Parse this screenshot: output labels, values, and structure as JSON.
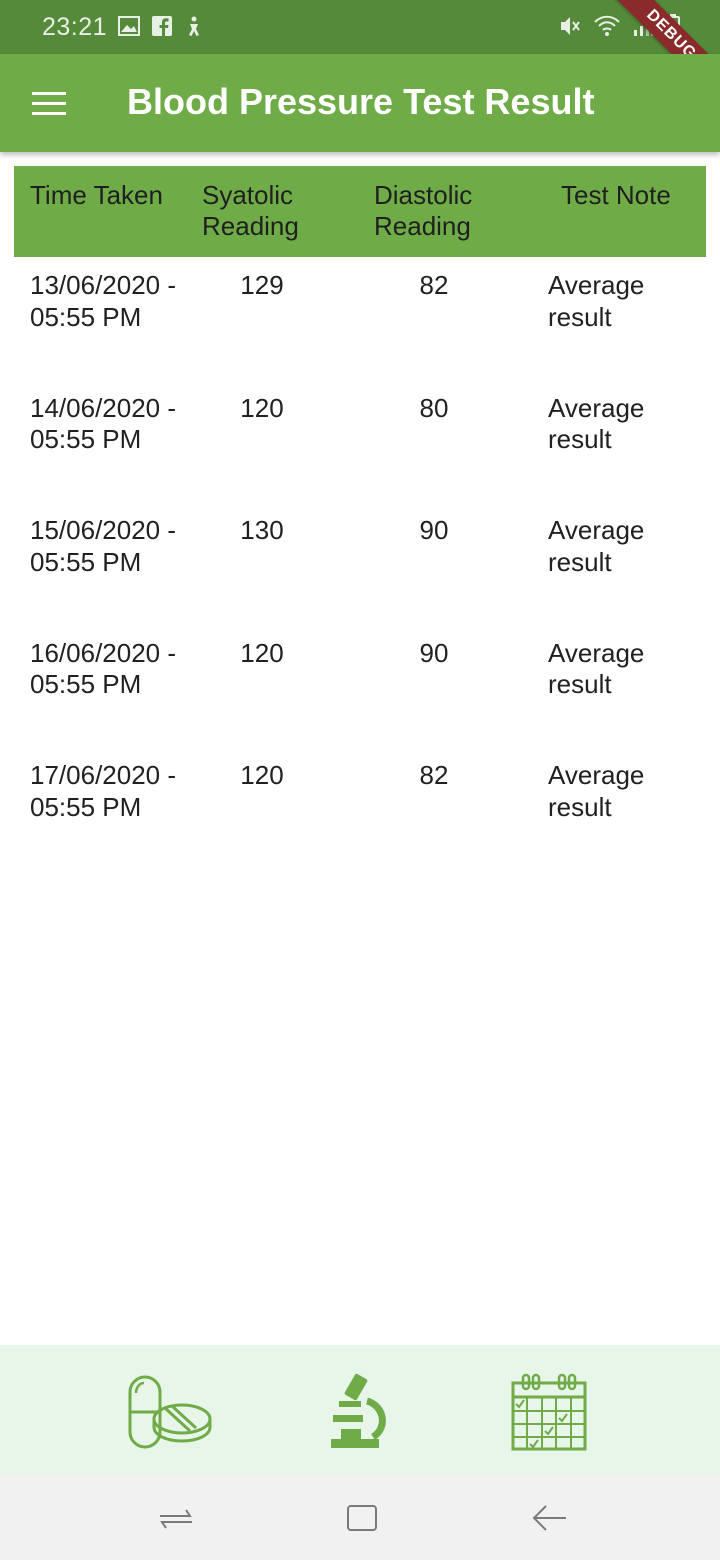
{
  "status_bar": {
    "time": "23:21",
    "left_icons": [
      "image-icon",
      "facebook-icon",
      "accessibility-icon"
    ],
    "right_icons": [
      "mute-icon",
      "wifi-icon",
      "signal-icon",
      "battery-icon"
    ],
    "debug_label": "DEBUG"
  },
  "app_bar": {
    "title": "Blood Pressure Test Result",
    "menu_icon": "menu-icon",
    "background": "#6fac48"
  },
  "table": {
    "headers": {
      "time": "Time Taken",
      "systolic": "Syatolic Reading",
      "diastolic": "Diastolic Reading",
      "note": "Test Note"
    },
    "rows": [
      {
        "time": "13/06/2020 - 05:55 PM",
        "systolic": "129",
        "diastolic": "82",
        "note": "Average result"
      },
      {
        "time": "14/06/2020 - 05:55 PM",
        "systolic": "120",
        "diastolic": "80",
        "note": "Average result"
      },
      {
        "time": "15/06/2020 - 05:55 PM",
        "systolic": "130",
        "diastolic": "90",
        "note": "Average result"
      },
      {
        "time": "16/06/2020 - 05:55 PM",
        "systolic": "120",
        "diastolic": "90",
        "note": "Average result"
      },
      {
        "time": "17/06/2020 - 05:55 PM",
        "systolic": "120",
        "diastolic": "82",
        "note": "Average result"
      }
    ]
  },
  "bottom_nav": {
    "items": [
      "pills-icon",
      "microscope-icon",
      "calendar-icon"
    ],
    "accent": "#6fac48",
    "background": "#e8f5e9"
  },
  "system_nav": {
    "items": [
      "recent-apps-icon",
      "home-icon",
      "back-icon"
    ]
  }
}
